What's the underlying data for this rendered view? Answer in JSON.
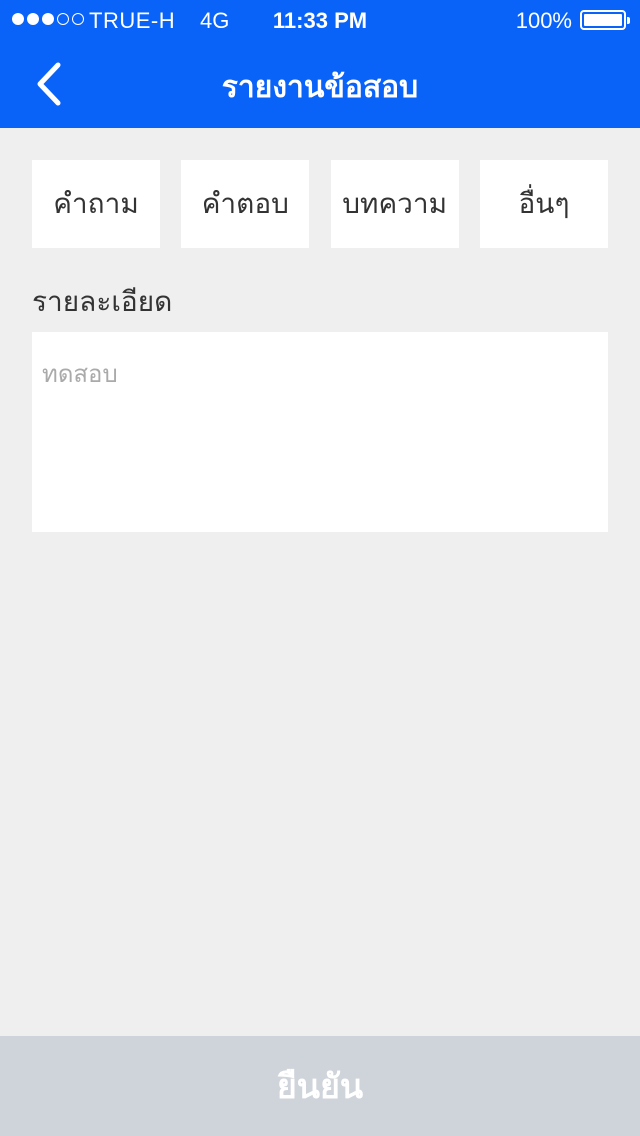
{
  "status_bar": {
    "carrier": "TRUE-H",
    "network": "4G",
    "time": "11:33 PM",
    "battery": "100%",
    "signal_bars_filled": 3,
    "signal_bars_total": 5
  },
  "nav": {
    "title": "รายงานข้อสอบ",
    "back_icon": "chevron-left-icon"
  },
  "tabs": [
    {
      "label": "คำถาม"
    },
    {
      "label": "คำตอบ"
    },
    {
      "label": "บทความ"
    },
    {
      "label": "อื่นๆ"
    }
  ],
  "details": {
    "label": "รายละเอียด",
    "placeholder": "ทดสอบ",
    "value": ""
  },
  "confirm": {
    "label": "ยืนยัน"
  },
  "colors": {
    "primary": "#0a63f8",
    "background": "#efefef",
    "button_disabled": "#cfd3da"
  }
}
